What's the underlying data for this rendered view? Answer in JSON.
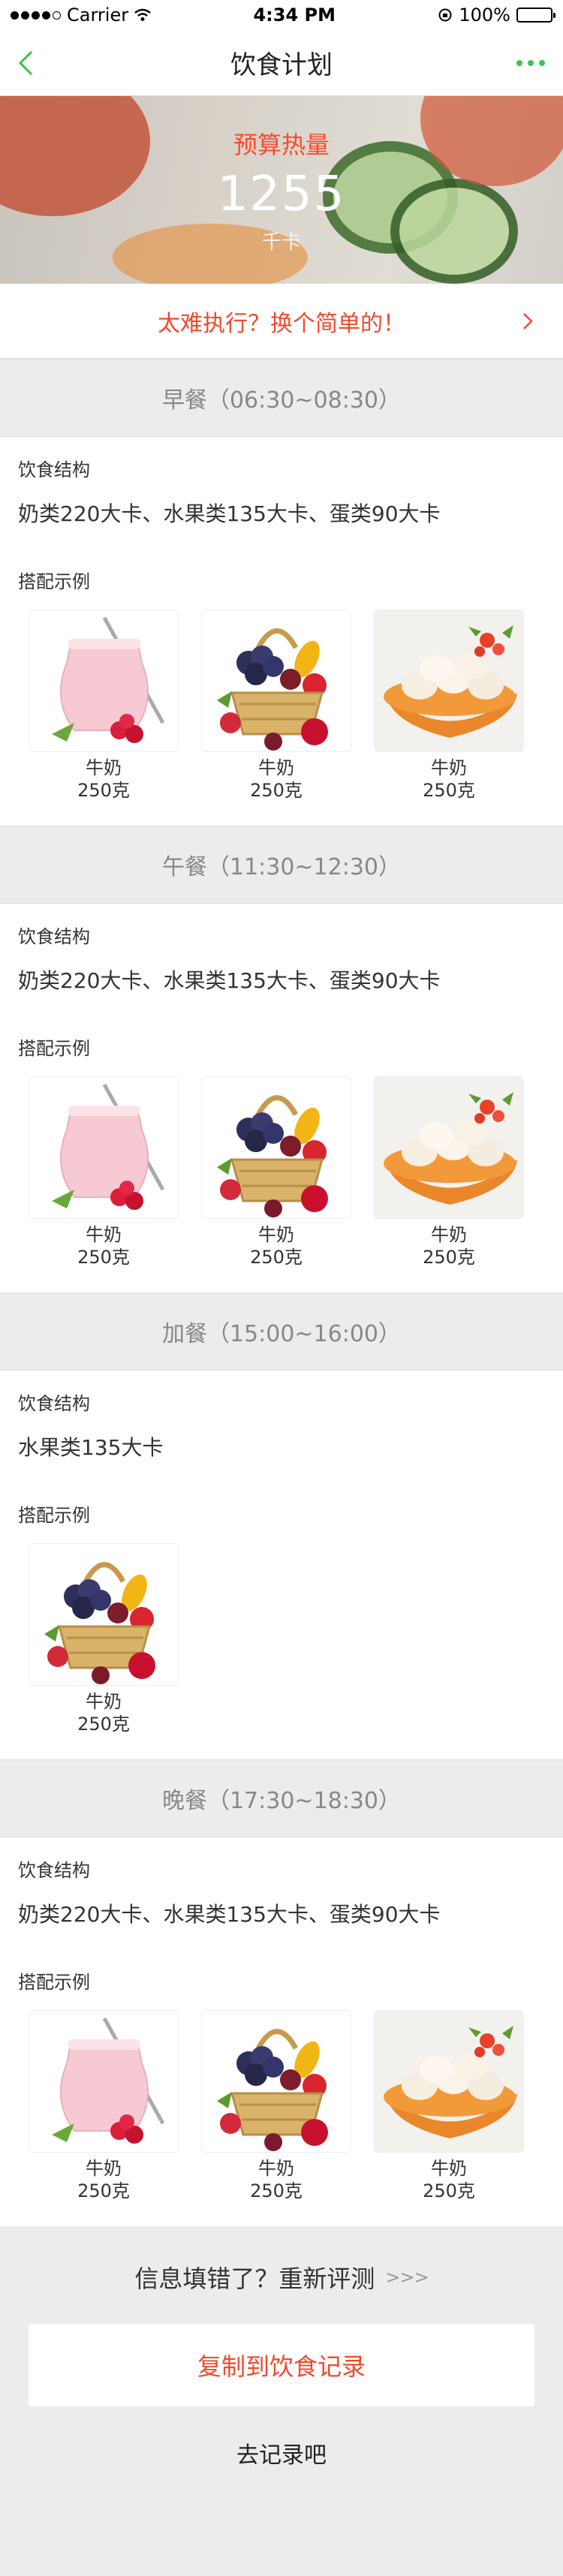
{
  "status_bar": {
    "carrier": "Carrier",
    "time": "4:34 PM",
    "battery": "100%"
  },
  "nav": {
    "title": "饮食计划"
  },
  "hero": {
    "label": "预算热量",
    "value": "1255",
    "unit": "千卡"
  },
  "switch_banner": {
    "text": "太难执行？换个简单的！"
  },
  "meals": [
    {
      "header": "早餐（06:30~08:30）",
      "structure_label": "饮食结构",
      "structure": "奶类220大卡、水果类135大卡、蛋类90大卡",
      "example_label": "搭配示例",
      "foods": [
        {
          "name": "牛奶",
          "amount": "250克",
          "image": "yogurt"
        },
        {
          "name": "牛奶",
          "amount": "250克",
          "image": "fruit-basket"
        },
        {
          "name": "牛奶",
          "amount": "250克",
          "image": "eggs"
        }
      ]
    },
    {
      "header": "午餐（11:30~12:30）",
      "structure_label": "饮食结构",
      "structure": "奶类220大卡、水果类135大卡、蛋类90大卡",
      "example_label": "搭配示例",
      "foods": [
        {
          "name": "牛奶",
          "amount": "250克",
          "image": "yogurt"
        },
        {
          "name": "牛奶",
          "amount": "250克",
          "image": "fruit-basket"
        },
        {
          "name": "牛奶",
          "amount": "250克",
          "image": "eggs"
        }
      ]
    },
    {
      "header": "加餐（15:00~16:00）",
      "structure_label": "饮食结构",
      "structure": "水果类135大卡",
      "example_label": "搭配示例",
      "foods": [
        {
          "name": "牛奶",
          "amount": "250克",
          "image": "fruit-basket"
        }
      ]
    },
    {
      "header": "晚餐（17:30~18:30）",
      "structure_label": "饮食结构",
      "structure": "奶类220大卡、水果类135大卡、蛋类90大卡",
      "example_label": "搭配示例",
      "foods": [
        {
          "name": "牛奶",
          "amount": "250克",
          "image": "yogurt"
        },
        {
          "name": "牛奶",
          "amount": "250克",
          "image": "fruit-basket"
        },
        {
          "name": "牛奶",
          "amount": "250克",
          "image": "eggs"
        }
      ]
    }
  ],
  "bottom": {
    "reeval_text": "信息填错了？重新评测",
    "reeval_arrows": ">>>",
    "copy_button": "复制到饮食记录",
    "record_link": "去记录吧"
  },
  "colors": {
    "accent_green": "#3cc34b",
    "accent_red": "#f04a2c",
    "background": "#ececec"
  }
}
